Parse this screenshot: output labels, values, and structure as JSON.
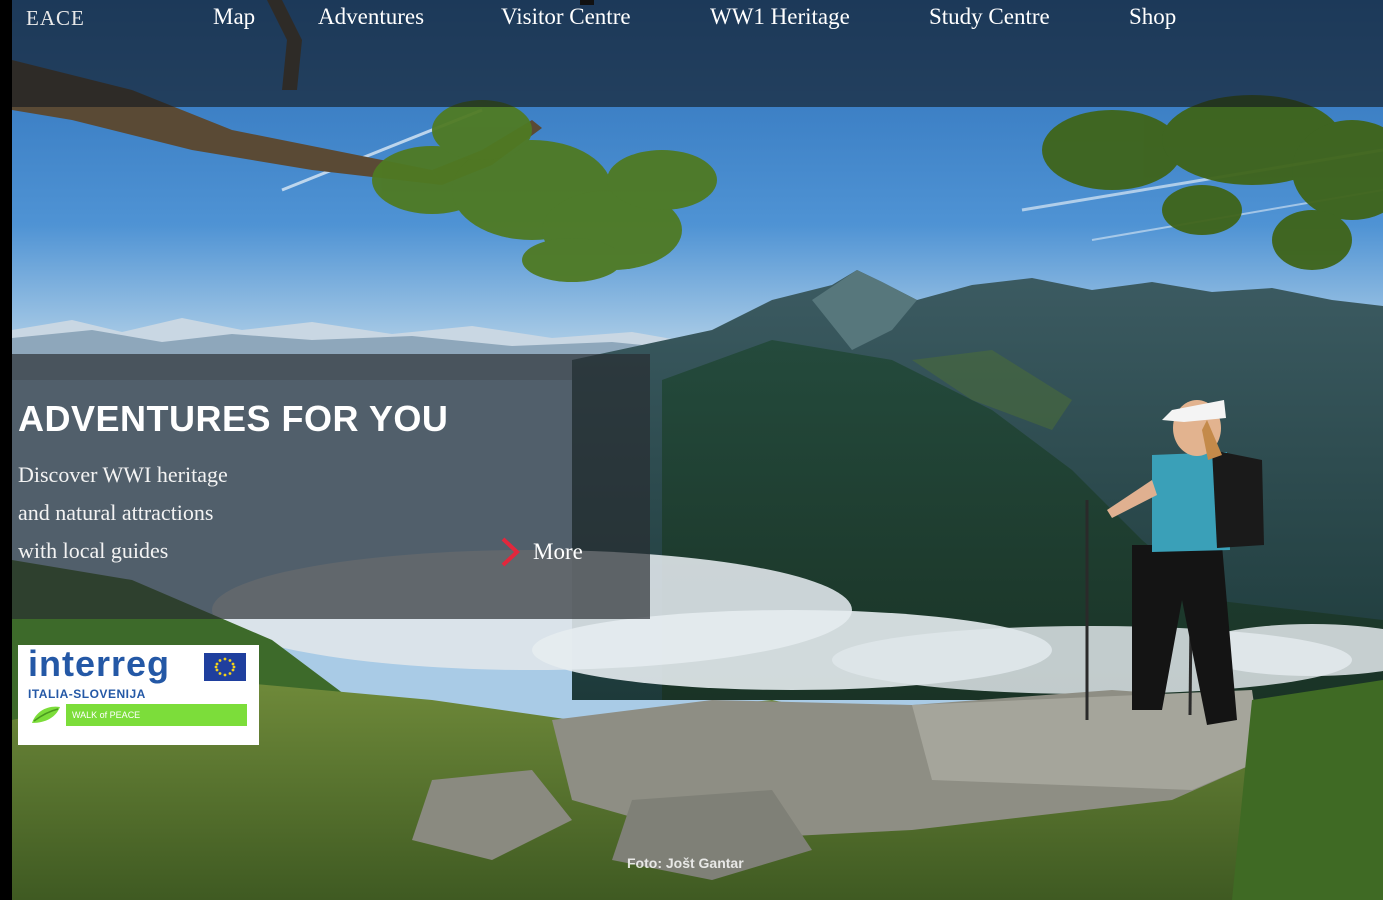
{
  "nav": {
    "brand": "EACE",
    "items": [
      {
        "label": "Map"
      },
      {
        "label": "Adventures"
      },
      {
        "label": "Visitor Centre"
      },
      {
        "label": "WW1 Heritage"
      },
      {
        "label": "Study Centre"
      },
      {
        "label": "Shop"
      }
    ]
  },
  "promo": {
    "title": "ADVENTURES FOR YOU",
    "lines": [
      "Discover WWI heritage",
      "and natural attractions",
      "with local guides"
    ],
    "more_label": "More",
    "accent": "#e2273c"
  },
  "logo": {
    "word": "interreg",
    "subtitle": "ITALIA-SLOVENIJA",
    "project": "WALK of PEACE",
    "brand_color": "#2458a6",
    "bar_color": "#7cdd3a"
  },
  "photo_credit": "Foto: Jošt Gantar",
  "icons": {
    "more": "chevron-right-icon",
    "flag": "eu-flag-icon",
    "leaf": "leaf-icon"
  }
}
